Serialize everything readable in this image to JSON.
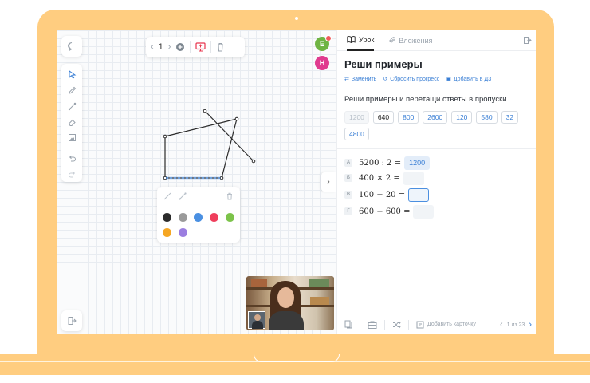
{
  "whiteboard": {
    "page_number": "1",
    "colors": [
      "#2b2b2b",
      "#9a9a9a",
      "#4a90e2",
      "#ef3e5c",
      "#7cc34a",
      "#f5a623",
      "#9b7ee0"
    ]
  },
  "participants": {
    "first_initial": "Е",
    "second_initial": "Н"
  },
  "lesson": {
    "tabs": [
      {
        "label": "Урок",
        "icon": "book-icon"
      },
      {
        "label": "Вложения",
        "icon": "paperclip-icon"
      }
    ],
    "title": "Реши примеры",
    "actions": [
      {
        "label": "Заменить",
        "icon": "swap-icon"
      },
      {
        "label": "Сбросить прогресс",
        "icon": "reset-icon"
      },
      {
        "label": "Добавить в ДЗ",
        "icon": "homework-icon"
      }
    ],
    "task_text": "Реши примеры и перетащи ответы в пропуски",
    "chips": [
      "1200",
      "640",
      "800",
      "2600",
      "120",
      "580",
      "32",
      "4800"
    ],
    "exercises": [
      {
        "letter": "А",
        "expression": "5200 : 2 =",
        "answer": "1200"
      },
      {
        "letter": "Б",
        "expression": "400 × 2 =",
        "answer": ""
      },
      {
        "letter": "В",
        "expression": "100 + 20 =",
        "answer": ""
      },
      {
        "letter": "Г",
        "expression": "600 + 600 =",
        "answer": ""
      }
    ],
    "bottom": {
      "add_card": "Добавить карточку",
      "pager": "1 из 23"
    }
  }
}
